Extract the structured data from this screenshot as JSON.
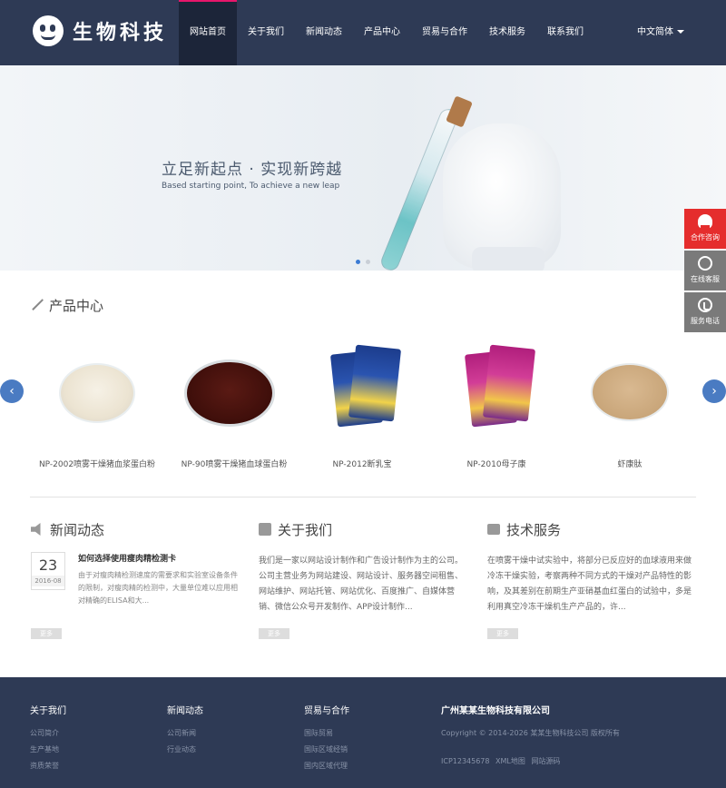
{
  "header": {
    "logo_text": "生物科技",
    "nav": [
      "网站首页",
      "关于我们",
      "新闻动态",
      "产品中心",
      "贸易与合作",
      "技术服务",
      "联系我们"
    ],
    "active_nav": "网站首页",
    "language": "中文简体"
  },
  "banner": {
    "title": "立足新起点 · 实现新跨越",
    "subtitle": "Based starting point, To achieve a new leap",
    "slides_total": 2,
    "active_slide": 1
  },
  "float_bar": {
    "items": [
      "合作咨询",
      "在线客服",
      "服务电话"
    ]
  },
  "products": {
    "heading": "产品中心",
    "items": [
      {
        "name": "NP-2002喷雾干燥猪血浆蛋白粉"
      },
      {
        "name": "NP-90喷雾干燥猪血球蛋白粉"
      },
      {
        "name": "NP-2012断乳宝"
      },
      {
        "name": "NP-2010母子康"
      },
      {
        "name": "虾康肽"
      }
    ]
  },
  "news": {
    "heading": "新闻动态",
    "item": {
      "day": "23",
      "year_month": "2016-08",
      "title": "如何选择使用瘦肉精检测卡",
      "summary": "由于对瘦肉精检测速度的需要求和实验室设备条件的限制，对瘦肉精的检测中，大量单位难以应用相对精确的ELISA和大..."
    },
    "more": "更多"
  },
  "about": {
    "heading": "关于我们",
    "text": "我们是一家以网站设计制作和广告设计制作为主的公司。公司主营业务为网站建设、网站设计、服务器空间租售、网站维护、网站托管、网站优化、百度推广、自媒体营销、微信公众号开发制作、APP设计制作...",
    "more": "更多"
  },
  "service": {
    "heading": "技术服务",
    "text": "在喷雾干燥中试实验中，将部分已反应好的血球液用来做冷冻干燥实验，考察两种不同方式的干燥对产品特性的影响，及其差别在前期生产亚硝基血红蛋白的试验中，多是利用真空冷冻干燥机生产产品的，许...",
    "more": "更多"
  },
  "footer": {
    "about": {
      "title": "关于我们",
      "links": [
        "公司简介",
        "生产基地",
        "资质荣誉"
      ]
    },
    "news": {
      "title": "新闻动态",
      "links": [
        "公司新闻",
        "行业动态"
      ]
    },
    "trade": {
      "title": "贸易与合作",
      "links": [
        "国际贸易",
        "国际区域经销",
        "国内区域代理"
      ]
    },
    "company": {
      "title": "广州某某生物科技有限公司",
      "copyright": "Copyright © 2014-2026 某某生物科技公司 版权所有",
      "icp": "ICP12345678",
      "xml_map": "XML地图",
      "source": "网站源码"
    }
  }
}
